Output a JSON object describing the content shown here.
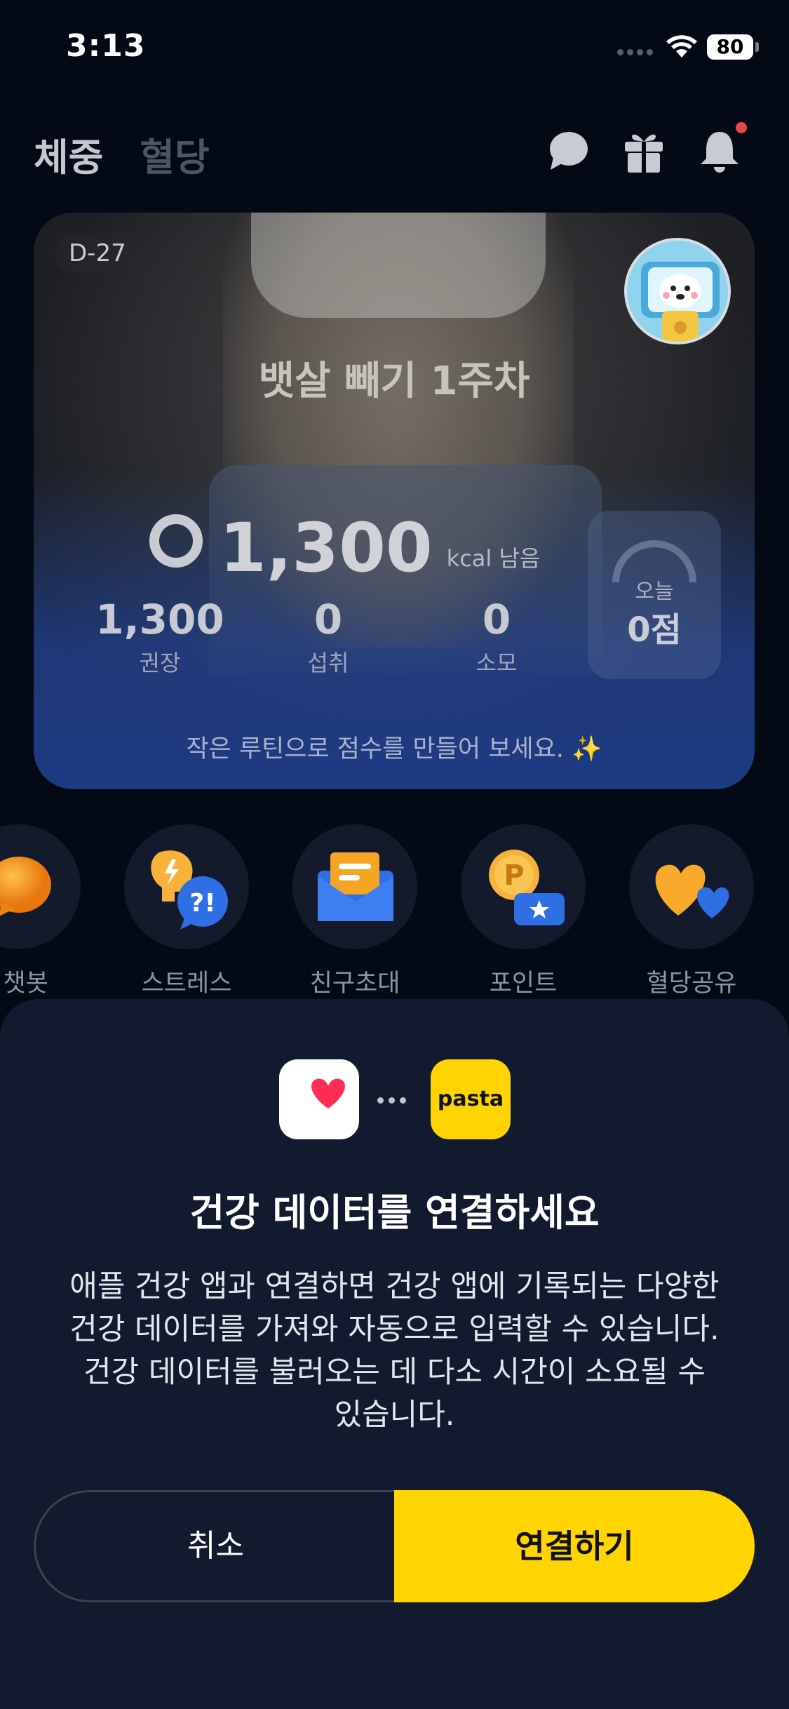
{
  "status_bar": {
    "time": "3:13",
    "battery": "80"
  },
  "header": {
    "tabs": [
      {
        "label": "체중"
      },
      {
        "label": "혈당"
      }
    ],
    "icons": [
      "chat-bubble-icon",
      "gift-icon",
      "bell-icon"
    ]
  },
  "hero": {
    "d_day": "D-27",
    "title": "뱃살 빼기 1주차",
    "kcal_remaining": "1,300",
    "kcal_unit": "kcal 남음",
    "stats": [
      {
        "value": "1,300",
        "label": "권장"
      },
      {
        "value": "0",
        "label": "섭취"
      },
      {
        "value": "0",
        "label": "소모"
      }
    ],
    "score": {
      "label": "오늘",
      "value": "0점"
    },
    "footer": "작은 루틴으로 점수를 만들어 보세요. ✨"
  },
  "menu": {
    "items": [
      {
        "label": "I 챗봇",
        "icon": "chatbot-icon"
      },
      {
        "label": "스트레스",
        "icon": "stress-icon"
      },
      {
        "label": "친구초대",
        "icon": "invite-icon"
      },
      {
        "label": "포인트",
        "icon": "point-icon"
      },
      {
        "label": "혈당공유",
        "icon": "share-heart-icon"
      }
    ]
  },
  "sheet": {
    "pasta_label": "pasta",
    "title": "건강 데이터를 연결하세요",
    "body_lines": [
      "애플 건강 앱과 연결하면 건강 앱에 기록되는 다양한",
      "건강 데이터를 가져와 자동으로 입력할 수 있습니다.",
      "건강 데이터를 불러오는 데 다소 시간이 소요될 수",
      "있습니다."
    ],
    "cancel_label": "취소",
    "connect_label": "연결하기"
  },
  "colors": {
    "background": "#040916",
    "sheet": "#111a2e",
    "accent": "#ffd400",
    "notification_dot": "#e9454a"
  }
}
